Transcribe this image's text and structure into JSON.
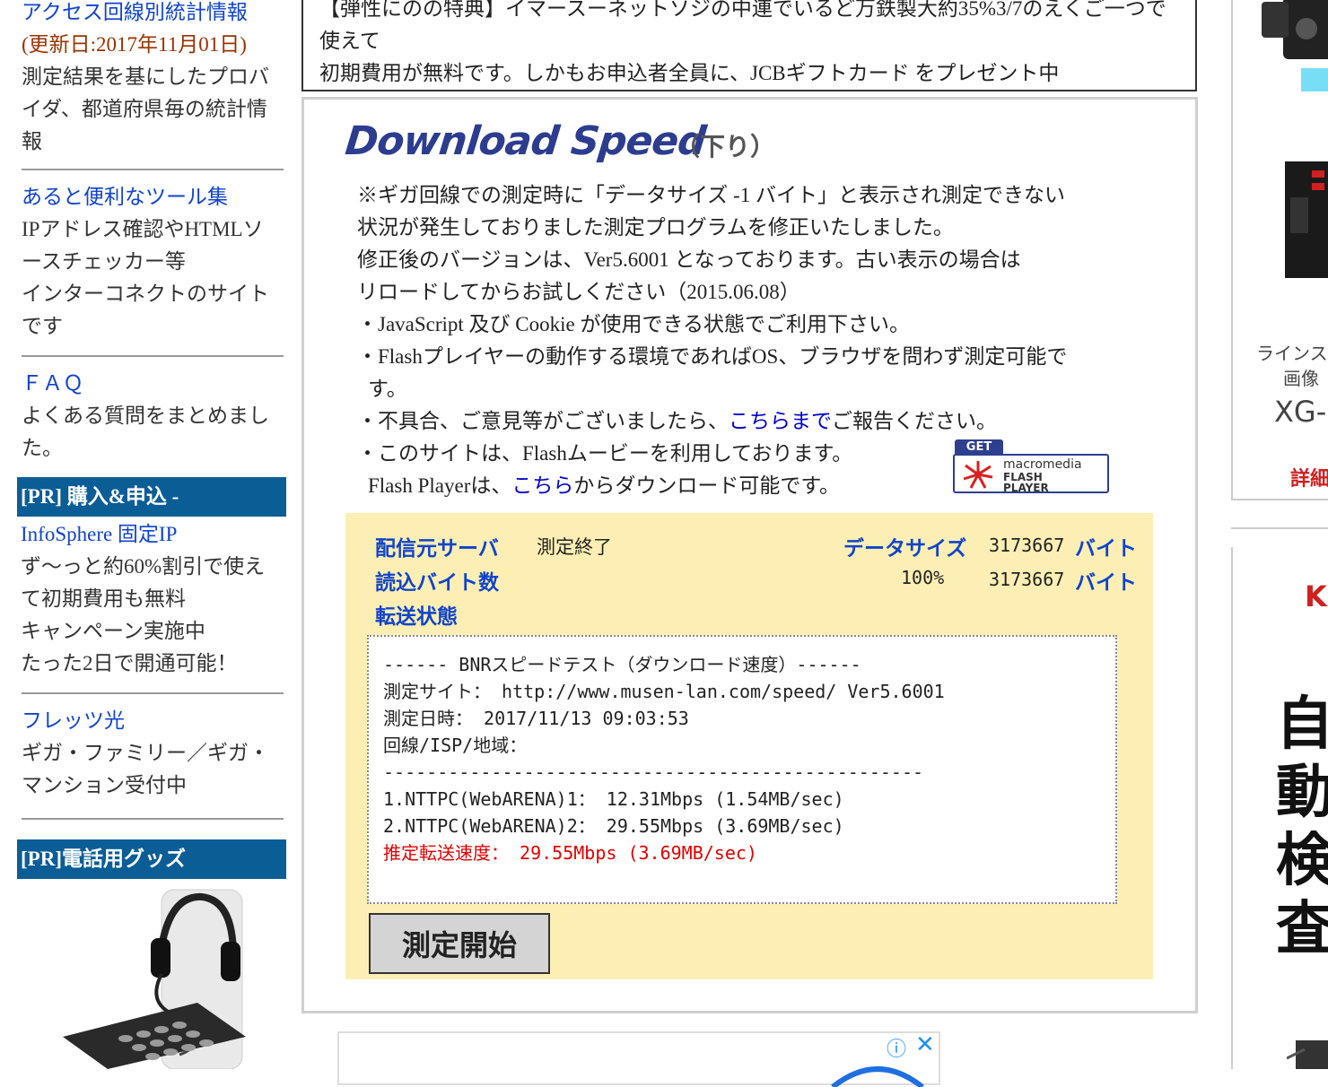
{
  "sidebar": {
    "stats": {
      "link": "アクセス回線別統計情報",
      "date": "(更新日:2017年11月01日)",
      "desc": [
        "測定結果を基にしたプロバ",
        "イダ、都道府県毎の統計情",
        "報"
      ]
    },
    "tools": {
      "link": "あると便利なツール集",
      "desc": [
        "IPアドレス確認やHTMLソ",
        "ースチェッカー等",
        "インターコネクトのサイト",
        "です"
      ]
    },
    "faq": {
      "link": "ＦＡＱ",
      "desc": [
        "よくある質問をまとめまし",
        "た。"
      ]
    },
    "pr1": {
      "header": "[PR] 購入&申込 -",
      "link": "InfoSphere 固定IP",
      "desc": [
        "ず〜っと約60%割引で使え",
        "て初期費用も無料",
        "キャンペーン実施中",
        "たった2日で開通可能！"
      ]
    },
    "flets": {
      "link": "フレッツ光",
      "desc": [
        "ギガ・ファミリー／ギガ・",
        "マンション受付中"
      ]
    },
    "pr2": {
      "header": "[PR]電話用グッズ"
    }
  },
  "notice": {
    "lines": [
      "【弾性にのの特典】イマースーネットソジの中連でいるど万鉄製大約35%3/7のえくご一つで",
      "使えて",
      "初期費用が無料です。しかもお申込者全員に、JCBギフトカード をプレゼント中"
    ]
  },
  "panel": {
    "title": "Download Speed",
    "subtitle": "（下り）",
    "info": {
      "l1": "※ギガ回線での測定時に「データサイズ -1 バイト」と表示され測定できない",
      "l2": "状況が発生しておりました測定プログラムを修正いたしました。",
      "l3": "修正後のバージョンは、Ver5.6001 となっております。古い表示の場合は",
      "l4": "リロードしてからお試しください（2015.06.08）",
      "l5": "・JavaScript 及び Cookie が使用できる状態でご利用下さい。",
      "l6": "・Flashプレイヤーの動作する環境であればOS、ブラウザを問わず測定可能で",
      "l7": "す。",
      "l8a": "・不具合、ご意見等がございましたら、",
      "l8link": "こちらまで",
      "l8b": "ご報告ください。",
      "l9": "・このサイトは、Flashムービーを利用しております。",
      "l10a": "Flash Playerは、",
      "l10link": "こちら",
      "l10b": "からダウンロード可能です。"
    },
    "flash_badge": {
      "get": "GET",
      "brand": "macromedia",
      "line1": "FLASH",
      "line2": "PLAYER"
    }
  },
  "result": {
    "server_label": "配信元サーバ",
    "server_value": "測定終了",
    "datasize_label": "データサイズ",
    "datasize_value": "3173667",
    "datasize_unit": "バイト",
    "read_label": "読込バイト数",
    "read_percent": "100%",
    "read_value": "3173667",
    "read_unit": "バイト",
    "transfer_label": "転送状態"
  },
  "log": {
    "l1": "------ BNRスピードテスト（ダウンロード速度）------",
    "l2": "測定サイト： http://www.musen-lan.com/speed/ Ver5.6001",
    "l3": "測定日時： 2017/11/13 09:03:53",
    "l4": "回線/ISP/地域：",
    "l5": "--------------------------------------------------",
    "l6": "1.NTTPC(WebARENA)1： 12.31Mbps (1.54MB/sec)",
    "l7": "2.NTTPC(WebARENA)2： 29.55Mbps (3.69MB/sec)",
    "l8": "推定転送速度： 29.55Mbps (3.69MB/sec)"
  },
  "start_button": "測定開始",
  "right_ad1": {
    "line1": "ラインス",
    "line2": "画像",
    "line3": "XG-",
    "cta": "詳細"
  },
  "right_ad2": {
    "brand": "K",
    "chars": [
      "自",
      "動",
      "検",
      "査"
    ]
  },
  "colors": {
    "link": "#1144cc",
    "pr_bar": "#0b5d96",
    "result_bg": "#fdefb4",
    "alert": "#e00000"
  }
}
